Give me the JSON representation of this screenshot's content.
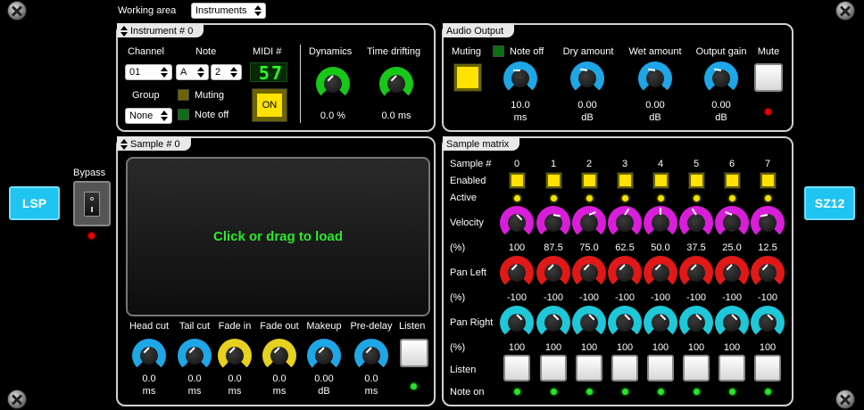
{
  "header": {
    "working_area_label": "Working area",
    "working_area_value": "Instruments"
  },
  "brand": {
    "left": "LSP",
    "right": "SZ12"
  },
  "bypass": {
    "label": "Bypass"
  },
  "instrument": {
    "title": "Instrument # 0",
    "channel_label": "Channel",
    "channel_value": "01",
    "note_label": "Note",
    "note_value": "A",
    "octave_value": "2",
    "midi_label": "MIDI #",
    "midi_value": "57",
    "group_label": "Group",
    "group_value": "None",
    "muting_label": "Muting",
    "noteoff_label": "Note off",
    "on_label": "ON",
    "dynamics_label": "Dynamics",
    "dynamics_value": "0.0 %",
    "time_drifting_label": "Time drifting",
    "time_drifting_value": "0.0 ms"
  },
  "audio_output": {
    "title": "Audio Output",
    "muting_label": "Muting",
    "noteoff_label": "Note off",
    "dry_label": "Dry amount",
    "wet_label": "Wet amount",
    "gain_label": "Output gain",
    "mute_label": "Mute",
    "muting_value": "10.0",
    "muting_unit": "ms",
    "dry_value": "0.00",
    "dry_unit": "dB",
    "wet_value": "0.00",
    "wet_unit": "dB",
    "gain_value": "0.00",
    "gain_unit": "dB"
  },
  "sample": {
    "title": "Sample # 0",
    "drop_text": "Click or drag to load",
    "listen_label": "Listen",
    "controls": [
      {
        "label": "Head cut",
        "value": "0.0",
        "unit": "ms",
        "color": "#1ea6e6"
      },
      {
        "label": "Tail cut",
        "value": "0.0",
        "unit": "ms",
        "color": "#1ea6e6"
      },
      {
        "label": "Fade in",
        "value": "0.0",
        "unit": "ms",
        "color": "#e6d21e"
      },
      {
        "label": "Fade out",
        "value": "0.0",
        "unit": "ms",
        "color": "#e6d21e"
      },
      {
        "label": "Makeup",
        "value": "0.00",
        "unit": "dB",
        "color": "#1ea6e6"
      },
      {
        "label": "Pre-delay",
        "value": "0.0",
        "unit": "ms",
        "color": "#1ea6e6"
      }
    ]
  },
  "matrix": {
    "title": "Sample matrix",
    "row_labels": {
      "sample": "Sample #",
      "enabled": "Enabled",
      "active": "Active",
      "velocity": "Velocity",
      "pct1": "(%)",
      "pan_left": "Pan Left",
      "pct2": "(%)",
      "pan_right": "Pan Right",
      "pct3": "(%)",
      "listen": "Listen",
      "note_on": "Note on"
    },
    "columns": [
      "0",
      "1",
      "2",
      "3",
      "4",
      "5",
      "6",
      "7"
    ],
    "velocity": [
      "100",
      "87.5",
      "75.0",
      "62.5",
      "50.0",
      "37.5",
      "25.0",
      "12.5"
    ],
    "pan_left": [
      "-100",
      "-100",
      "-100",
      "-100",
      "-100",
      "-100",
      "-100",
      "-100"
    ],
    "pan_right": [
      "100",
      "100",
      "100",
      "100",
      "100",
      "100",
      "100",
      "100"
    ],
    "colors": {
      "velocity": "#d81ed8",
      "pan_left": "#e01818",
      "pan_right": "#1ec8d8"
    }
  }
}
